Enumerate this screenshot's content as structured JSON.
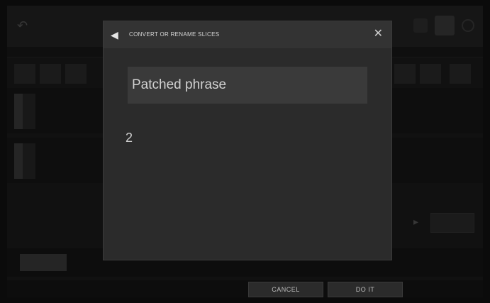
{
  "dialog": {
    "title": "CONVERT OR RENAME SLICES",
    "name_value": "Patched phrase",
    "count_value": "2",
    "close_icon": "close-icon",
    "header_icon": "speaker-icon"
  },
  "footer": {
    "cancel_label": "CANCEL",
    "do_it_label": "DO IT"
  },
  "colors": {
    "background": "#1b1b1b",
    "dialog": "#2b2b2b",
    "input": "#3a3a3a"
  }
}
